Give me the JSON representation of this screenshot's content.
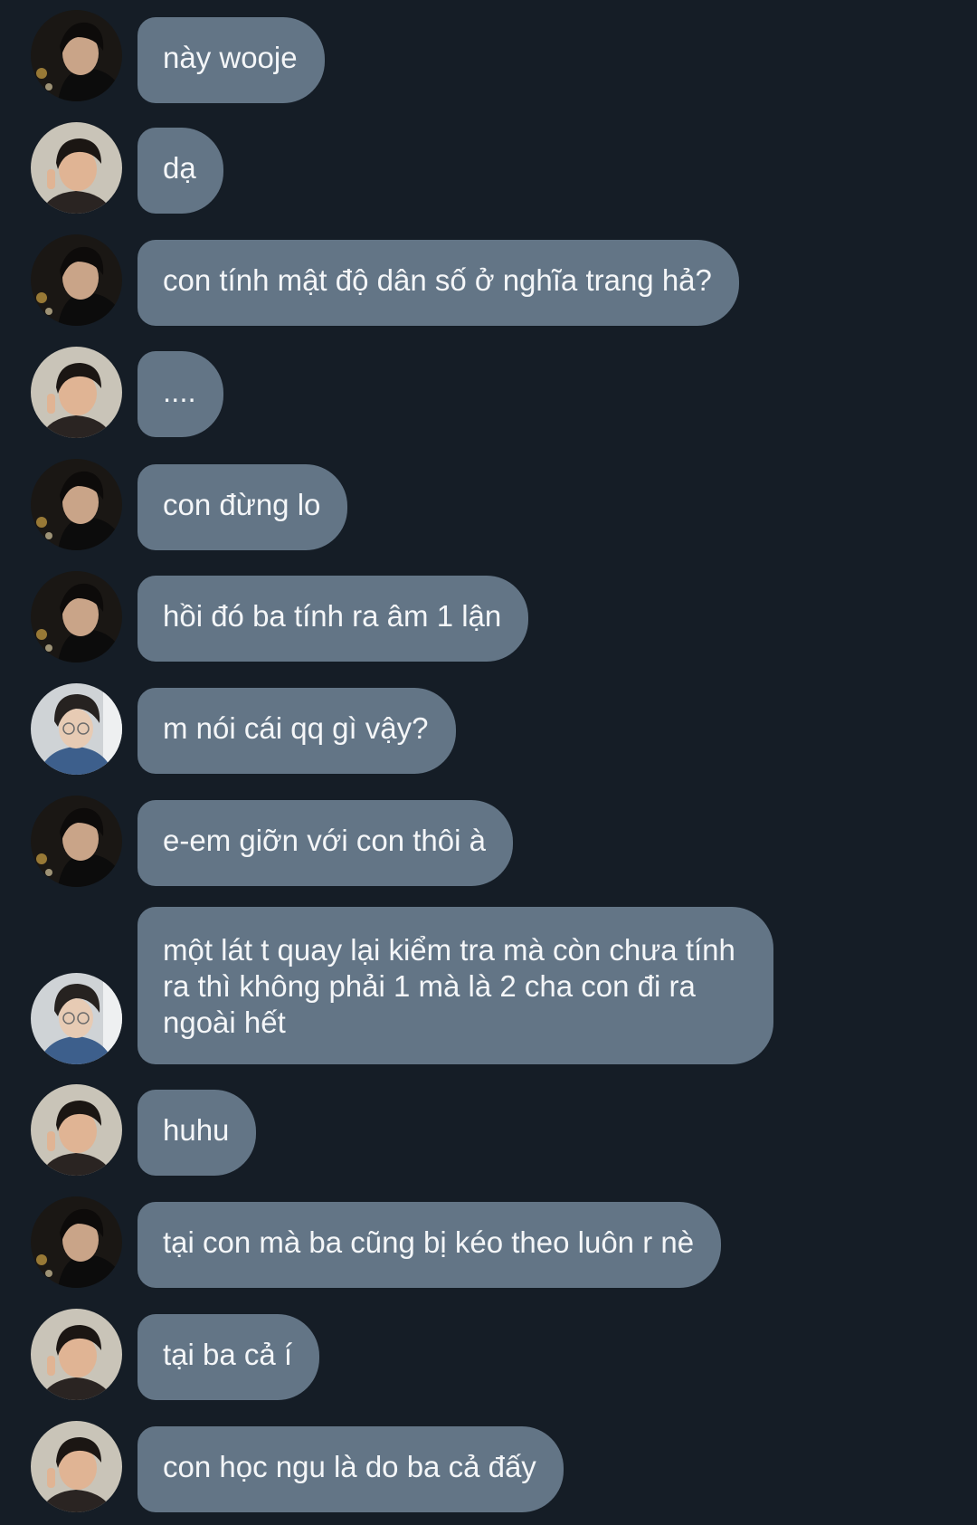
{
  "conversation": {
    "messages": [
      {
        "sender": "dad",
        "text": "này wooje"
      },
      {
        "sender": "kid",
        "text": "dạ"
      },
      {
        "sender": "dad",
        "text": "con tính mật độ dân số ở nghĩa trang hả?"
      },
      {
        "sender": "kid",
        "text": "...."
      },
      {
        "sender": "dad",
        "text": "con đừng lo"
      },
      {
        "sender": "dad",
        "text": "hồi đó ba tính ra âm 1 lận"
      },
      {
        "sender": "other",
        "text": "m nói cái qq gì vậy?"
      },
      {
        "sender": "dad",
        "text": "e-em giỡn với con thôi à"
      },
      {
        "sender": "other",
        "text": "một lát t quay lại kiểm tra mà còn chưa tính\nra thì không phải 1 mà là 2 cha con đi ra\nngoài hết"
      },
      {
        "sender": "kid",
        "text": "huhu"
      },
      {
        "sender": "dad",
        "text": "tại con mà ba cũng bị kéo theo luôn r nè"
      },
      {
        "sender": "kid",
        "text": "tại ba cả í"
      },
      {
        "sender": "kid",
        "text": "con học ngu là do ba cả đấy"
      }
    ]
  },
  "colors": {
    "background": "#151d26",
    "bubble": "#637586",
    "bubble_text": "#f4f6f8"
  },
  "icons": {
    "dad": "avatar-dark-hair-photo",
    "kid": "avatar-child-peace-sign-photo",
    "other": "avatar-glasses-denim-photo"
  }
}
